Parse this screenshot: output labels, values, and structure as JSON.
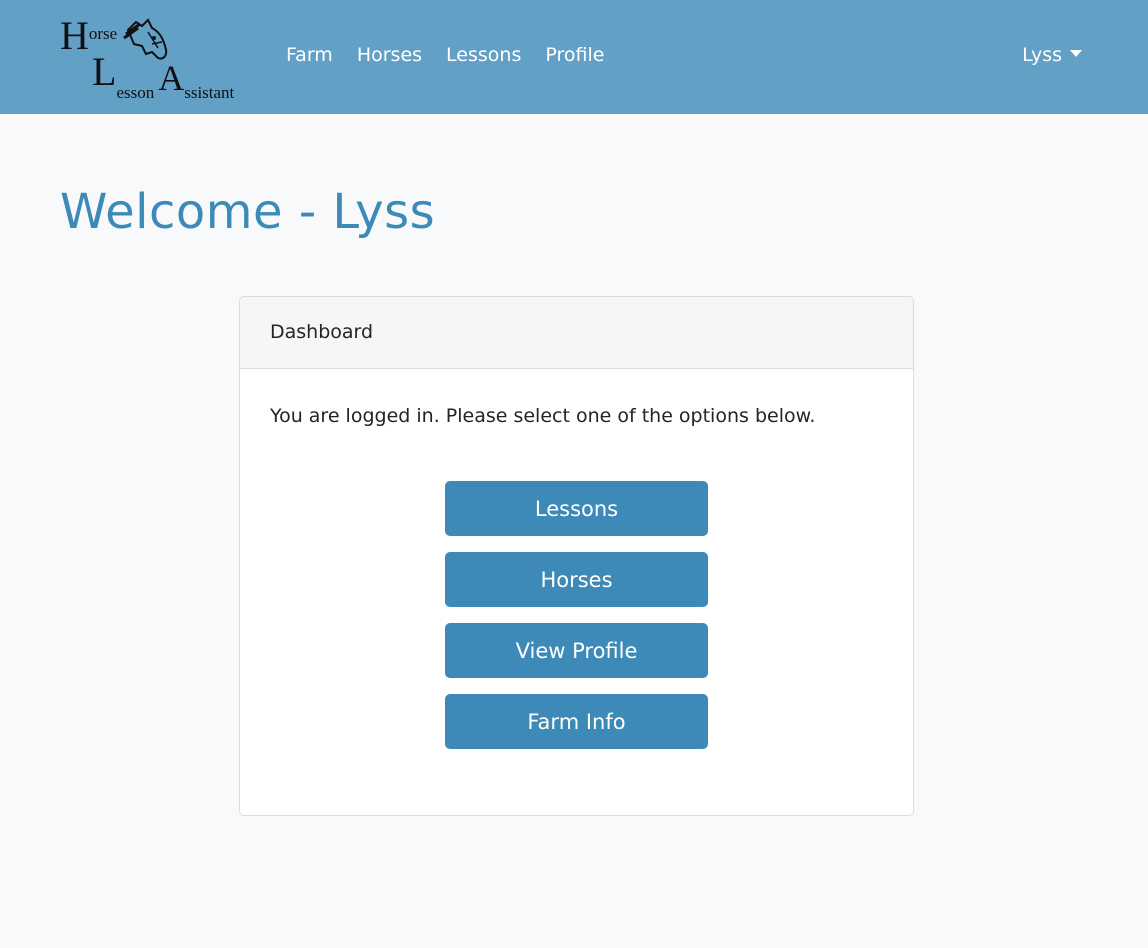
{
  "brand": {
    "logo_text_line1": "Horse",
    "logo_text_line2": "Lesson Assistant",
    "logo_icon": "horse-head-icon"
  },
  "nav": {
    "links": [
      {
        "label": "Farm"
      },
      {
        "label": "Horses"
      },
      {
        "label": "Lessons"
      },
      {
        "label": "Profile"
      }
    ],
    "user_label": "Lyss",
    "user_icon": "caret-down-icon"
  },
  "page": {
    "title": "Welcome - Lyss"
  },
  "dashboard": {
    "header": "Dashboard",
    "message": "You are logged in. Please select one of the options below.",
    "buttons": [
      {
        "label": "Lessons"
      },
      {
        "label": "Horses"
      },
      {
        "label": "View Profile"
      },
      {
        "label": "Farm Info"
      }
    ]
  },
  "colors": {
    "navbar": "#63a0c5",
    "accent": "#3d8ab8",
    "page_background": "#f8f9fb"
  }
}
